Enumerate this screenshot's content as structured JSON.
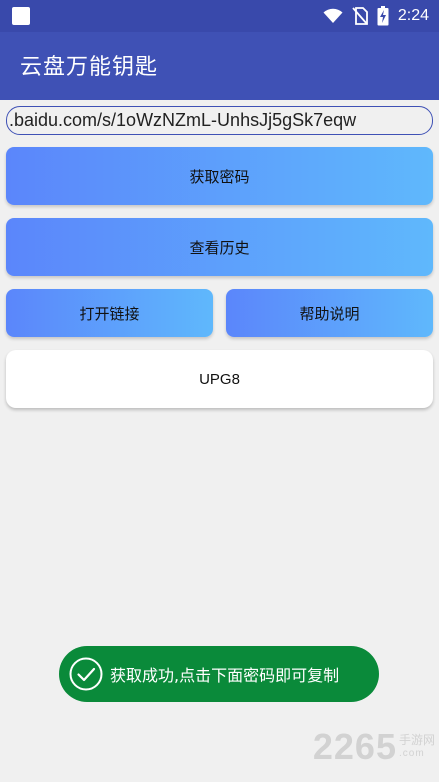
{
  "status_bar": {
    "time": "2:24",
    "icons": [
      "wifi-icon",
      "no-sim-icon",
      "battery-charging-icon"
    ]
  },
  "app_bar": {
    "title": "云盘万能钥匙"
  },
  "url_input": {
    "value": ".baidu.com/s/1oWzNZmL-UnhsJj5gSk7eqw"
  },
  "buttons": {
    "get_password": "获取密码",
    "view_history": "查看历史",
    "open_link": "打开链接",
    "help": "帮助说明"
  },
  "result": {
    "password": "UPG8"
  },
  "toast": {
    "message": "获取成功,点击下面密码即可复制",
    "icon": "check-circle-icon",
    "color": "#0a8a3a"
  },
  "watermark": {
    "number": "2265",
    "cn": "手游网",
    "domain": ".com"
  },
  "colors": {
    "primary": "#3f51b5",
    "primary_dark": "#3949ab",
    "button_gradient_start": "#5b86fb",
    "button_gradient_end": "#5fb8fc"
  }
}
